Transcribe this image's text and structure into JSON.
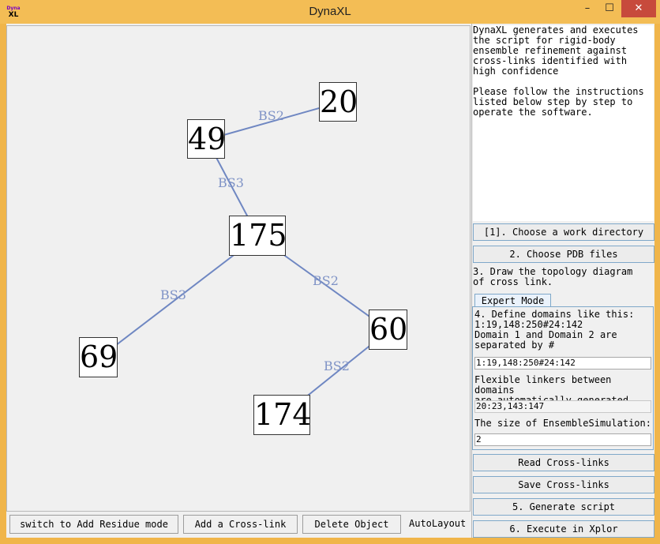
{
  "window": {
    "title": "DynaXL",
    "icon_text_top": "Dyna",
    "icon_text_bottom": "XL",
    "minimize_glyph": "–",
    "maximize_glyph": "☐",
    "close_glyph": "✕"
  },
  "graph": {
    "nodes": [
      {
        "id": "n20",
        "label": "20"
      },
      {
        "id": "n49",
        "label": "49"
      },
      {
        "id": "n175",
        "label": "175"
      },
      {
        "id": "n60",
        "label": "60"
      },
      {
        "id": "n69",
        "label": "69"
      },
      {
        "id": "n174",
        "label": "174"
      }
    ],
    "edges": [
      {
        "from": "n49",
        "to": "n20",
        "label": "BS2"
      },
      {
        "from": "n49",
        "to": "n175",
        "label": "BS3"
      },
      {
        "from": "n175",
        "to": "n60",
        "label": "BS2"
      },
      {
        "from": "n175",
        "to": "n69",
        "label": "BS3"
      },
      {
        "from": "n60",
        "to": "n174",
        "label": "BS2"
      }
    ],
    "edge_color": "#6f87c2"
  },
  "toolbar": {
    "switch_mode": "switch to Add Residue mode",
    "add_crosslink": "Add a Cross-link",
    "delete_object": "Delete Object",
    "autolayout": "AutoLayout"
  },
  "panel": {
    "description": "DynaXL generates and executes\nthe script for rigid-body\nensemble refinement against\ncross-links identified with\nhigh confidence\n\nPlease follow the instructions\nlisted below step by step to\noperate the software.",
    "step1": "[1]. Choose a work directory",
    "step2": "2. Choose PDB files",
    "step3": "3. Draw the topology diagram\nof cross link.",
    "tab_label": "Expert Mode",
    "step4": "4. Define domains like this:\n1:19,148:250#24:142\nDomain 1 and Domain 2 are\nseparated by #",
    "domain_value": "1:19,148:250#24:142",
    "linkers_text": "Flexible linkers between domains\nare automatically generated.",
    "linkers_value": "20:23,143:147",
    "ensemble_label": "The size of EnsembleSimulation:",
    "ensemble_value": "2",
    "read_crosslinks": "Read Cross-links",
    "save_crosslinks": "Save Cross-links",
    "step5": "5. Generate script",
    "step6": "6. Execute in Xplor"
  }
}
